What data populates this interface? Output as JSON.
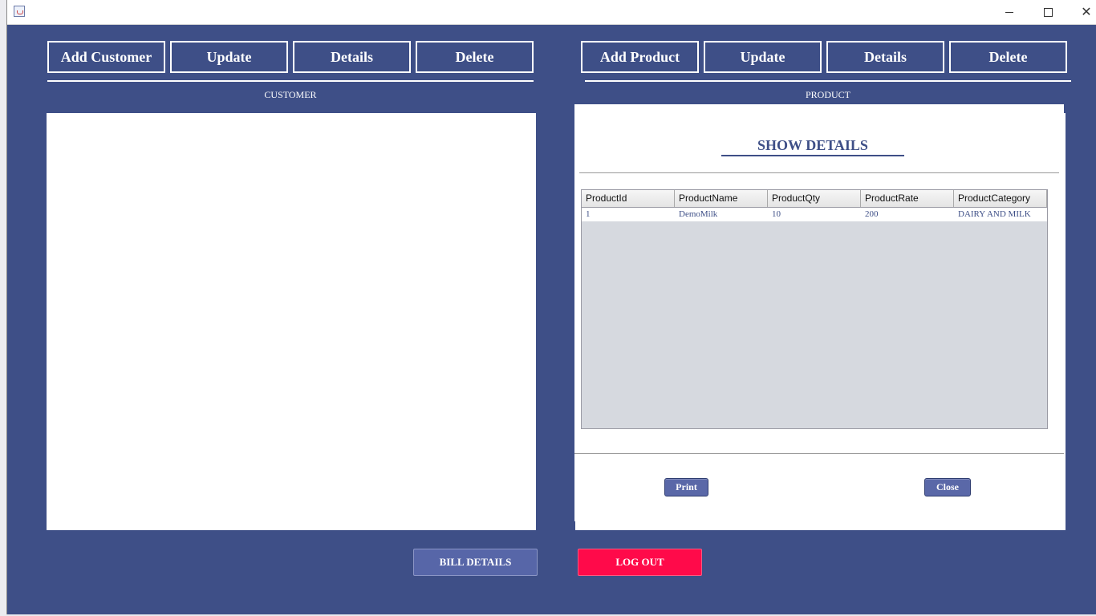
{
  "window": {
    "title": "",
    "icon": "java-cup-icon"
  },
  "colors": {
    "background": "#3e4f87",
    "logout": "#ff0a4a",
    "button": "#5a68a8"
  },
  "customer": {
    "buttons": {
      "add": "Add Customer",
      "update": "Update",
      "details": "Details",
      "delete": "Delete"
    },
    "label": "CUSTOMER"
  },
  "product": {
    "buttons": {
      "add": "Add Product",
      "update": "Update",
      "details": "Details",
      "delete": "Delete"
    },
    "label": "PRODUCT"
  },
  "dialog": {
    "title": "SHOW DETAILS",
    "columns": [
      "ProductId",
      "ProductName",
      "ProductQty",
      "ProductRate",
      "ProductCategory"
    ],
    "rows": [
      [
        "1",
        "DemoMilk",
        "10",
        "200",
        "DAIRY AND MILK"
      ]
    ],
    "print_label": "Print",
    "close_label": "Close"
  },
  "footer": {
    "bill_label": "BILL DETAILS",
    "logout_label": "LOG OUT"
  }
}
